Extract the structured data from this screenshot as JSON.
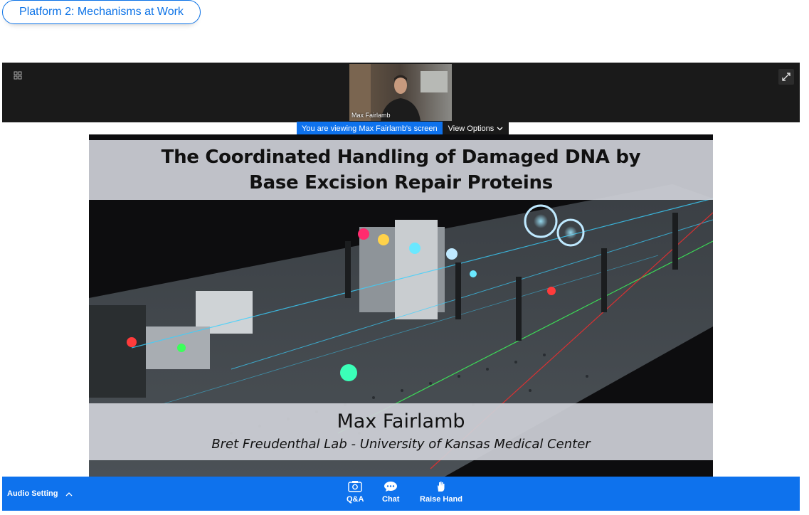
{
  "session": {
    "title": "Platform 2: Mechanisms at Work"
  },
  "meeting": {
    "participant_thumbnail": {
      "name": "Max Fairlamb"
    },
    "share_banner": {
      "text": "You are viewing Max Fairlamb's screen",
      "view_options_label": "View Options"
    }
  },
  "slide": {
    "title_line1": "The Coordinated Handling of Damaged DNA by",
    "title_line2": "Base Excision Repair Proteins",
    "presenter": "Max Fairlamb",
    "affiliation": "Bret Freudenthal Lab - University of Kansas Medical Center"
  },
  "controls": {
    "audio_setting": "Audio Setting",
    "qa": "Q&A",
    "chat": "Chat",
    "raise_hand": "Raise Hand"
  },
  "colors": {
    "accent": "#0e72ed",
    "pill_border": "#0b72e7",
    "stage_dark": "#1a1a1a"
  },
  "icons": [
    "grid-view-icon",
    "fullscreen-icon",
    "chevron-down-icon",
    "chevron-up-icon",
    "qa-icon",
    "chat-icon",
    "raise-hand-icon"
  ]
}
